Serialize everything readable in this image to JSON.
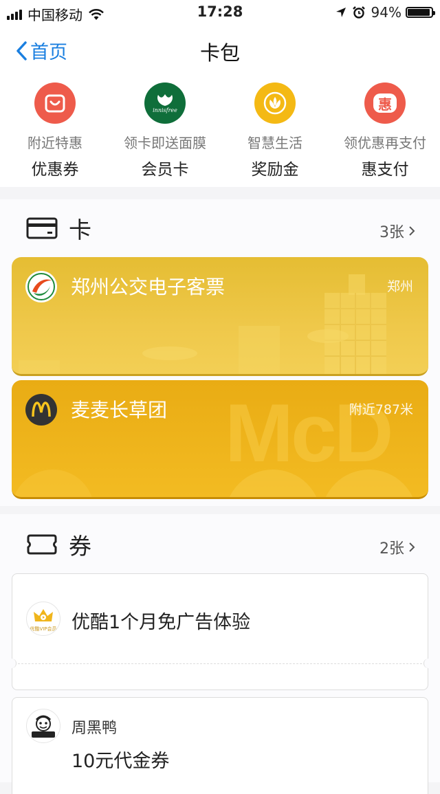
{
  "status_bar": {
    "carrier": "中国移动",
    "time": "17:28",
    "battery": "94%",
    "battery_level": 0.94
  },
  "nav": {
    "back_label": "首页",
    "title": "卡包"
  },
  "quick_actions": [
    {
      "sub": "附近特惠",
      "main": "优惠券",
      "color": "#ee5b4b",
      "icon": "coupon-bag-icon"
    },
    {
      "sub": "领卡即送面膜",
      "main": "会员卡",
      "color": "#0f6e3a",
      "icon": "innisfree-logo-icon",
      "logo_text": "innisfree"
    },
    {
      "sub": "智慧生活",
      "main": "奖励金",
      "color": "#f4b914",
      "icon": "reward-leaf-icon"
    },
    {
      "sub": "领优惠再支付",
      "main": "惠支付",
      "color": "#ee5b4b",
      "icon": "hui-pay-icon",
      "glyph": "惠"
    }
  ],
  "cards_section": {
    "title": "卡",
    "count": "3张",
    "icon": "card-icon"
  },
  "cards": [
    {
      "name": "郑州公交电子客票",
      "tag": "郑州",
      "icon": "zhengzhou-bus-logo-icon"
    },
    {
      "name": "麦麦长草团",
      "tag": "附近787米",
      "icon": "mcdonalds-logo-icon",
      "watermark": "McD"
    }
  ],
  "coupons_section": {
    "title": "券",
    "count": "2张",
    "icon": "ticket-icon"
  },
  "coupons": [
    {
      "title": "优酷1个月免广告体验",
      "icon": "youku-vip-crown-icon",
      "badge": "优酷VIP会员"
    },
    {
      "brand": "周黑鸭",
      "title": "10元代金券",
      "icon": "zhouheiya-logo-icon"
    }
  ]
}
